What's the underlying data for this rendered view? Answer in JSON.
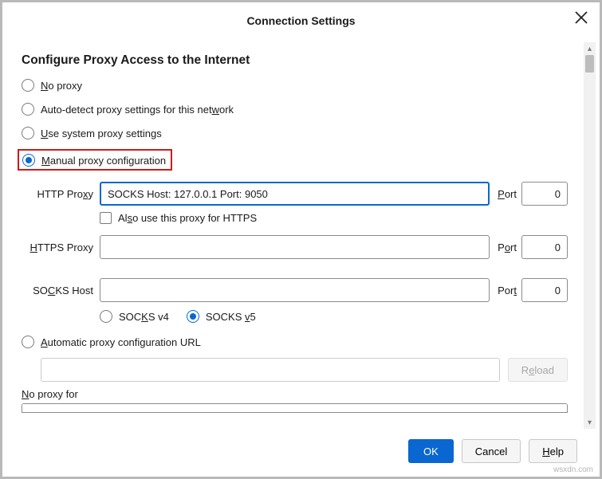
{
  "header": {
    "title": "Connection Settings"
  },
  "section_heading": "Configure Proxy Access to the Internet",
  "radios": {
    "no_proxy_pre": "",
    "no_proxy_u": "N",
    "no_proxy_post": "o proxy",
    "autodetect_pre": "Auto-detect proxy settings for this net",
    "autodetect_u": "w",
    "autodetect_post": "ork",
    "system_u": "U",
    "system_post": "se system proxy settings",
    "manual_u": "M",
    "manual_post": "anual proxy configuration",
    "autoconf_u": "A",
    "autoconf_post": "utomatic proxy configuration URL"
  },
  "http": {
    "label_pre": "HTTP Pro",
    "label_u": "x",
    "label_post": "y",
    "value": "SOCKS Host: 127.0.0.1 Port: 9050",
    "port_u": "P",
    "port_post": "ort",
    "port_value": "0"
  },
  "also_https": {
    "pre": "Al",
    "u": "s",
    "post": "o use this proxy for HTTPS"
  },
  "https": {
    "label_u": "H",
    "label_post": "TTPS Proxy",
    "value": "",
    "port_pre": "P",
    "port_u": "o",
    "port_post": "rt",
    "port_value": "0"
  },
  "socks": {
    "label_pre": "SO",
    "label_u": "C",
    "label_post": "KS Host",
    "value": "",
    "port_pre": "Por",
    "port_u": "t",
    "port_value": "0",
    "v4_pre": "SOC",
    "v4_u": "K",
    "v4_post": "S v4",
    "v5_pre": "SOCKS ",
    "v5_u": "v",
    "v5_post": "5"
  },
  "pac": {
    "reload_u": "e",
    "reload_pre": "R",
    "reload_post": "load"
  },
  "no_proxy_for": {
    "u": "N",
    "post": "o proxy for"
  },
  "buttons": {
    "ok": "OK",
    "cancel": "Cancel",
    "help_u": "H",
    "help_post": "elp"
  },
  "watermark": "wsxdn.com"
}
